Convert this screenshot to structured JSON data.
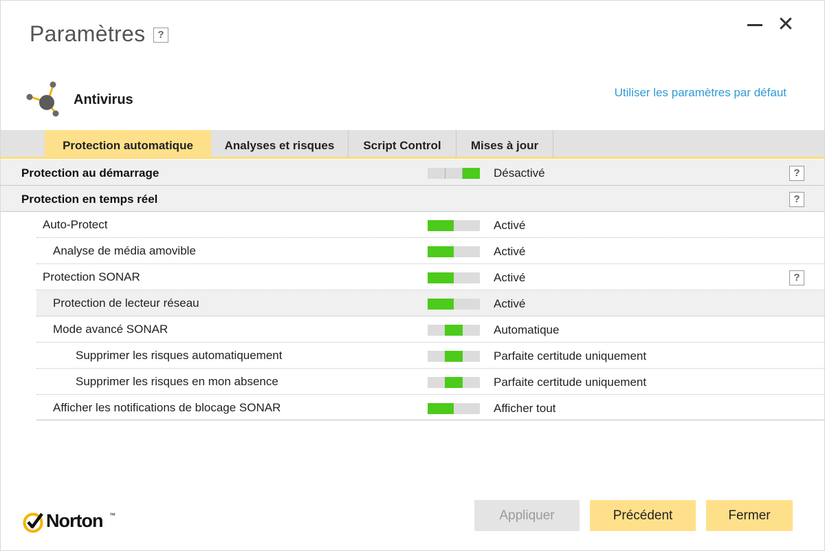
{
  "window": {
    "title": "Paramètres",
    "title_help": "?",
    "close_glyph": "✕"
  },
  "section": {
    "title": "Antivirus",
    "default_link": "Utiliser les paramètres par défaut"
  },
  "tabs": [
    {
      "label": "Protection automatique",
      "active": true
    },
    {
      "label": "Analyses et risques",
      "active": false
    },
    {
      "label": "Script Control",
      "active": false
    },
    {
      "label": "Mises à jour",
      "active": false
    }
  ],
  "groups": [
    {
      "label": "Protection au démarrage",
      "value": "Désactivé",
      "toggle": "three-state-right",
      "help": "?"
    },
    {
      "label": "Protection en temps réel",
      "help": "?"
    }
  ],
  "rows": [
    {
      "label": "Auto-Protect",
      "value": "Activé",
      "toggle": "on",
      "indent": 1
    },
    {
      "label": "Analyse de média amovible",
      "value": "Activé",
      "toggle": "on",
      "indent": 2
    },
    {
      "label": "Protection SONAR",
      "value": "Activé",
      "toggle": "on",
      "indent": 1,
      "help": "?"
    },
    {
      "label": "Protection de lecteur réseau",
      "value": "Activé",
      "toggle": "on",
      "indent": 2,
      "highlight": true
    },
    {
      "label": "Mode avancé SONAR",
      "value": "Automatique",
      "toggle": "middle",
      "indent": 2
    },
    {
      "label": "Supprimer les risques automatiquement",
      "value": "Parfaite certitude uniquement",
      "toggle": "middle",
      "indent": 3
    },
    {
      "label": "Supprimer les risques en mon absence",
      "value": "Parfaite certitude uniquement",
      "toggle": "middle",
      "indent": 3
    },
    {
      "label": "Afficher les notifications de blocage SONAR",
      "value": "Afficher tout",
      "toggle": "on",
      "indent": 2
    }
  ],
  "footer": {
    "brand": "Norton",
    "brand_tm": "™",
    "apply_label": "Appliquer",
    "prev_label": "Précédent",
    "close_label": "Fermer"
  },
  "colors": {
    "accent_yellow": "#ffe08a",
    "toggle_green": "#4ccb1b",
    "link_blue": "#2e9bd6"
  }
}
